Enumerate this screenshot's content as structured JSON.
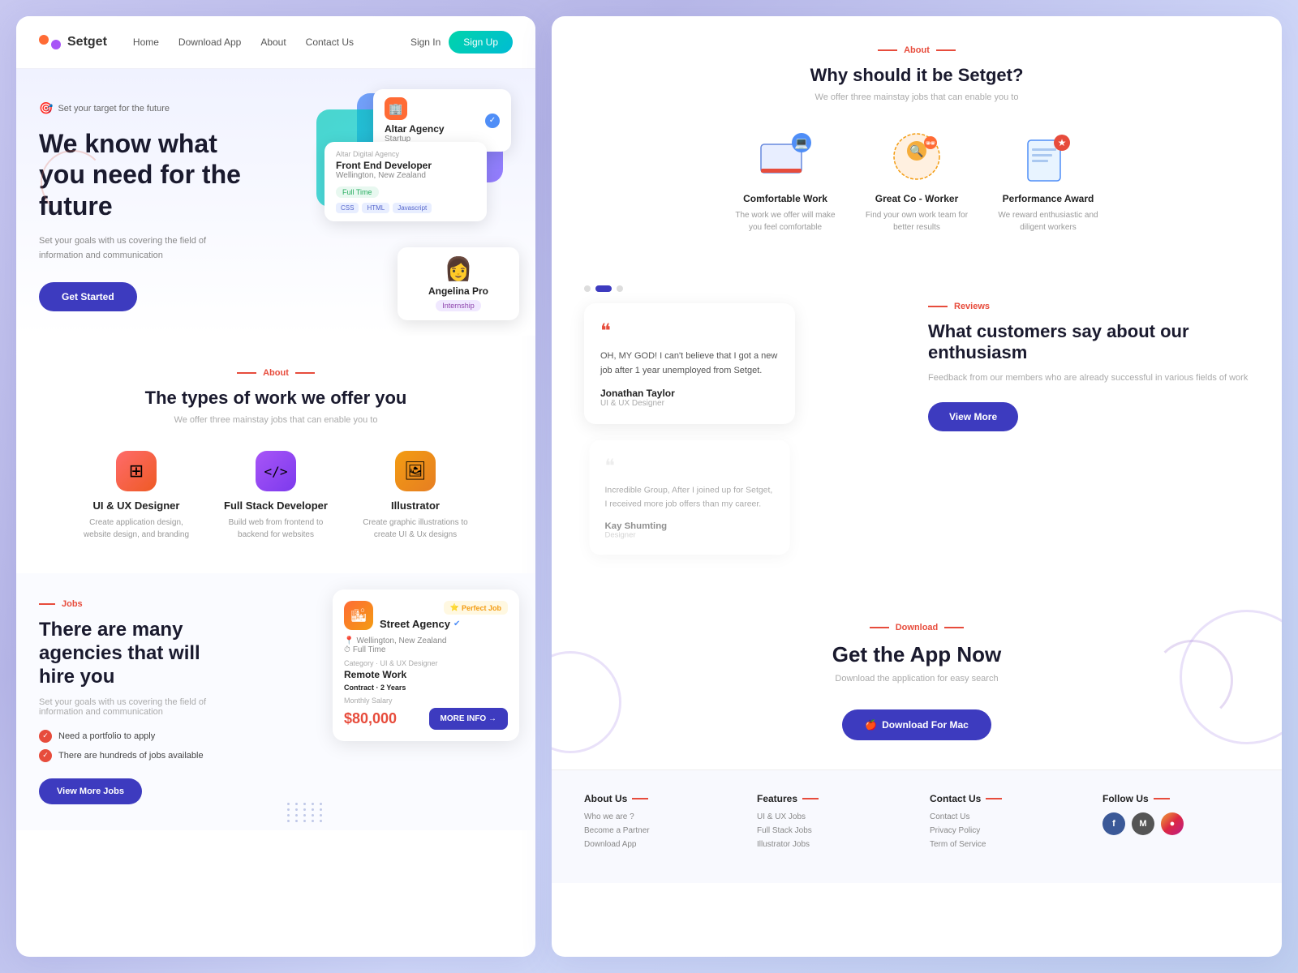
{
  "nav": {
    "logo": "Setget",
    "links": [
      "Home",
      "Download App",
      "About",
      "Contact Us"
    ],
    "signin": "Sign In",
    "signup": "Sign Up"
  },
  "hero": {
    "badge": "Set your target for the future",
    "title": "We know what you need for the future",
    "subtitle": "Set your goals with us covering the field of information and communication",
    "cta": "Get Started",
    "card1": {
      "name": "Altar Agency",
      "type": "Startup"
    },
    "card2": {
      "agency": "Altar Digital Agency",
      "role": "Front End Developer",
      "location": "Wellington, New Zealand",
      "fulltime": "Full Time",
      "tags": [
        "CSS",
        "HTML",
        "Javascript"
      ]
    },
    "card3": {
      "name": "Angelina Pro",
      "type": "Internship"
    }
  },
  "about_left": {
    "label": "About",
    "title": "The types of work we offer you",
    "subtitle": "We offer three mainstay jobs that can enable you to",
    "features": [
      {
        "icon": "⊞",
        "name": "UI & UX Designer",
        "desc": "Create application design, website design, and branding"
      },
      {
        "icon": "</>",
        "name": "Full Stack Developer",
        "desc": "Build web from frontend to backend for websites"
      },
      {
        "icon": "🖼",
        "name": "Illustrator",
        "desc": "Create graphic illustrations to create UI & Ux designs"
      }
    ]
  },
  "jobs": {
    "label": "Jobs",
    "title": "There are many agencies that will hire you",
    "subtitle": "Set your goals with us covering the field of information and communication",
    "checklist": [
      "Need a portfolio to apply",
      "There are hundreds of jobs available"
    ],
    "cta": "View More Jobs",
    "card": {
      "badge": "Perfect Job",
      "company": "Street Agency",
      "location": "Wellington, New Zealand",
      "type": "Full Time",
      "category": "Category · UI & UX Designer",
      "role": "Remote Work",
      "contract_label": "Contract ·",
      "contract_value": "2 Years",
      "salary_label": "Monthly Salary",
      "salary": "$80,000",
      "cta": "MORE INFO →"
    }
  },
  "about_right": {
    "label": "About",
    "title": "Why should it be Setget?",
    "subtitle": "We offer three mainstay jobs that can enable you to",
    "features": [
      {
        "name": "Comfortable Work",
        "desc": "The work we offer will make you feel comfortable",
        "emoji": "💻"
      },
      {
        "name": "Great Co - Worker",
        "desc": "Find your own work team for better results",
        "emoji": "🔍"
      },
      {
        "name": "Performance Award",
        "desc": "We reward enthusiastic and diligent workers",
        "emoji": "📋"
      }
    ]
  },
  "reviews": {
    "label": "Reviews",
    "title": "What customers say about our enthusiasm",
    "subtitle": "Feedback from our members who are already successful in various fields of work",
    "cta": "View More",
    "cards": [
      {
        "text": "OH, MY GOD! I can't believe that I got a new job after 1 year unemployed from Setget.",
        "author": "Jonathan Taylor",
        "role": "UI & UX Designer"
      },
      {
        "text": "Incredible Group, After I joined up for Setget, I received more job offers than my career.",
        "author": "Kay Shumting",
        "role": "Designer"
      }
    ]
  },
  "download": {
    "label": "Download",
    "title": "Get the App Now",
    "subtitle": "Download the application for easy search",
    "cta": "Download For Mac"
  },
  "footer": {
    "cols": [
      {
        "title": "About Us",
        "links": [
          "Who we are ?",
          "Become a Partner",
          "Download App"
        ]
      },
      {
        "title": "Features",
        "links": [
          "UI & UX Jobs",
          "Full Stack Jobs",
          "Illustrator Jobs"
        ]
      },
      {
        "title": "Contact Us",
        "links": [
          "Contact Us",
          "Privacy Policy",
          "Term of Service"
        ]
      },
      {
        "title": "Follow Us",
        "socials": [
          "f",
          "M",
          "●"
        ]
      }
    ]
  }
}
